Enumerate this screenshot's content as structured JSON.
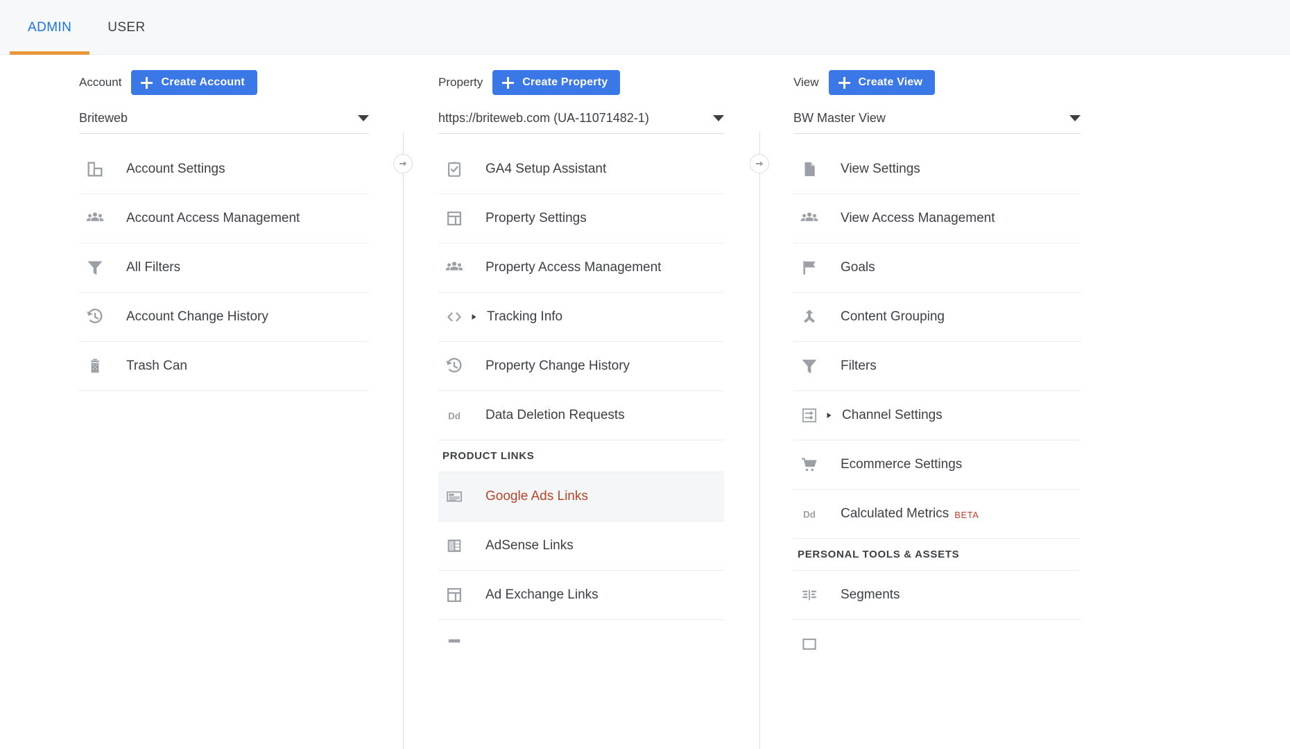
{
  "tabs": [
    {
      "label": "ADMIN",
      "active": true
    },
    {
      "label": "USER",
      "active": false
    }
  ],
  "colors": {
    "accent_blue": "#3b78e7",
    "tab_active": "#1a73e8",
    "tab_underline": "#e8973a",
    "highlight_link": "#b5462a",
    "beta_red": "#c5402c",
    "icon_gray": "#9aa0a6",
    "text": "#3c4043"
  },
  "columns": {
    "account": {
      "label": "Account",
      "create_button": "Create Account",
      "selected": "Briteweb",
      "items": [
        {
          "label": "Account Settings",
          "icon": "building-icon"
        },
        {
          "label": "Account Access Management",
          "icon": "people-icon"
        },
        {
          "label": "All Filters",
          "icon": "funnel-icon"
        },
        {
          "label": "Account Change History",
          "icon": "history-icon"
        },
        {
          "label": "Trash Can",
          "icon": "trash-icon"
        }
      ]
    },
    "property": {
      "label": "Property",
      "create_button": "Create Property",
      "selected": "https://briteweb.com (UA-11071482-1)",
      "items": [
        {
          "label": "GA4 Setup Assistant",
          "icon": "clipboard-check-icon"
        },
        {
          "label": "Property Settings",
          "icon": "layout-icon"
        },
        {
          "label": "Property Access Management",
          "icon": "people-icon"
        },
        {
          "label": "Tracking Info",
          "icon": "code-icon",
          "expandable": true
        },
        {
          "label": "Property Change History",
          "icon": "history-icon"
        },
        {
          "label": "Data Deletion Requests",
          "icon": "dd-icon"
        }
      ],
      "section": {
        "title": "PRODUCT LINKS",
        "items": [
          {
            "label": "Google Ads Links",
            "icon": "ads-card-icon",
            "highlighted": true
          },
          {
            "label": "AdSense Links",
            "icon": "adsense-icon"
          },
          {
            "label": "Ad Exchange Links",
            "icon": "layout-icon"
          },
          {
            "label": "",
            "icon": "partial-icon",
            "partial": true
          }
        ]
      }
    },
    "view": {
      "label": "View",
      "create_button": "Create View",
      "selected": "BW Master View",
      "items": [
        {
          "label": "View Settings",
          "icon": "document-icon"
        },
        {
          "label": "View Access Management",
          "icon": "people-icon"
        },
        {
          "label": "Goals",
          "icon": "flag-icon"
        },
        {
          "label": "Content Grouping",
          "icon": "merge-icon"
        },
        {
          "label": "Filters",
          "icon": "funnel-icon"
        },
        {
          "label": "Channel Settings",
          "icon": "channel-icon",
          "expandable": true
        },
        {
          "label": "Ecommerce Settings",
          "icon": "cart-icon"
        },
        {
          "label": "Calculated Metrics",
          "icon": "dd-icon",
          "badge": "BETA"
        }
      ],
      "section": {
        "title": "PERSONAL TOOLS & ASSETS",
        "items": [
          {
            "label": "Segments",
            "icon": "segments-icon"
          },
          {
            "label": "",
            "icon": "partial-icon",
            "partial": true
          }
        ]
      }
    }
  }
}
